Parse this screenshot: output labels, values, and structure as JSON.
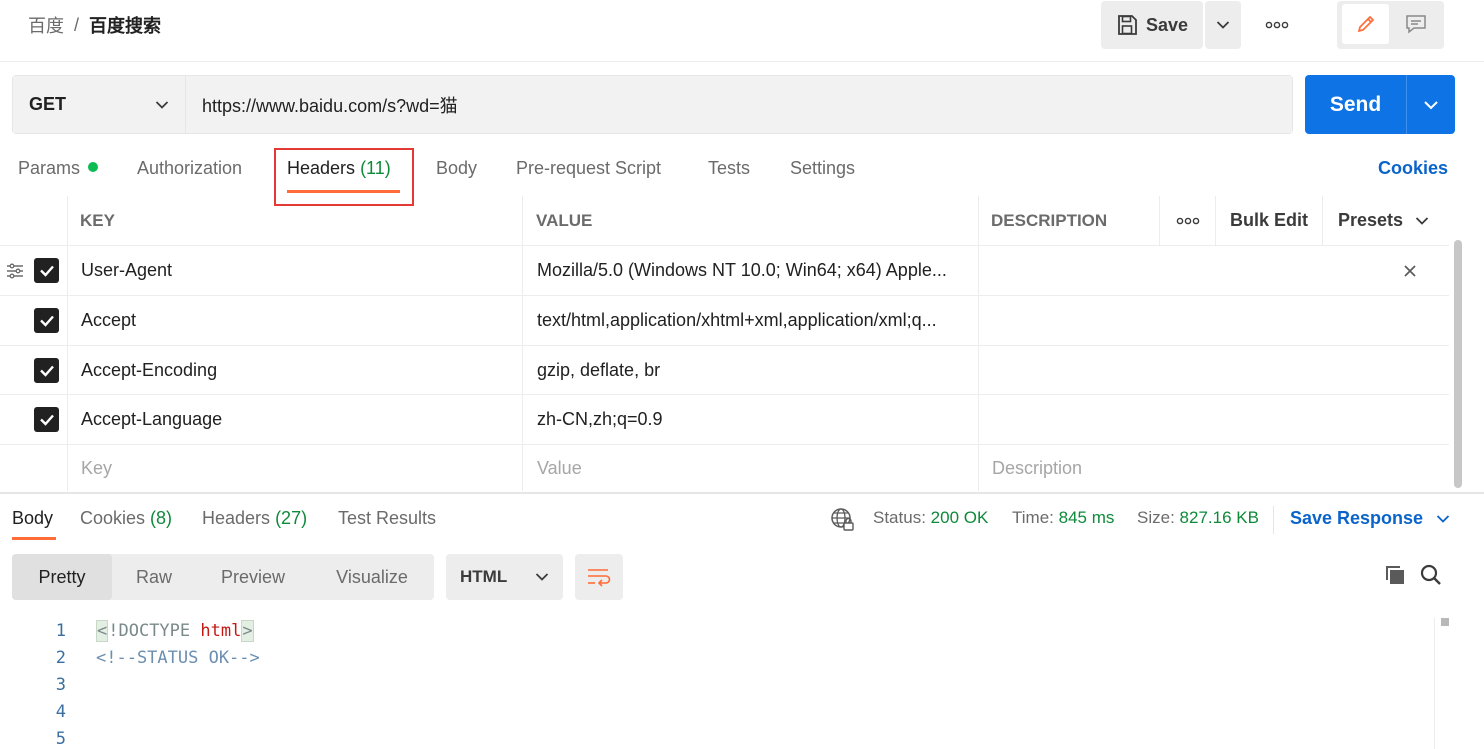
{
  "breadcrumb": {
    "parent": "百度",
    "separator": "/",
    "current": "百度搜索"
  },
  "toolbar": {
    "save_label": "Save",
    "more_icon": "more-horizontal-icon"
  },
  "request": {
    "method": "GET",
    "url": "https://www.baidu.com/s?wd=猫",
    "send_label": "Send"
  },
  "request_tabs": {
    "params": "Params",
    "authorization": "Authorization",
    "headers": "Headers",
    "headers_count": "(11)",
    "body": "Body",
    "pre_request": "Pre-request Script",
    "tests": "Tests",
    "settings": "Settings",
    "cookies": "Cookies"
  },
  "headers_table": {
    "columns": {
      "key": "KEY",
      "value": "VALUE",
      "description": "DESCRIPTION",
      "bulk_edit": "Bulk Edit",
      "presets": "Presets"
    },
    "rows": [
      {
        "key": "User-Agent",
        "value": "Mozilla/5.0 (Windows NT 10.0; Win64; x64) Apple...",
        "description": "",
        "checked": true
      },
      {
        "key": "Accept",
        "value": "text/html,application/xhtml+xml,application/xml;q...",
        "description": "",
        "checked": true
      },
      {
        "key": "Accept-Encoding",
        "value": "gzip, deflate, br",
        "description": "",
        "checked": true
      },
      {
        "key": "Accept-Language",
        "value": "zh-CN,zh;q=0.9",
        "description": "",
        "checked": true
      }
    ],
    "placeholders": {
      "key": "Key",
      "value": "Value",
      "description": "Description"
    }
  },
  "response": {
    "tabs": {
      "body": "Body",
      "cookies": "Cookies",
      "cookies_count": "(8)",
      "headers": "Headers",
      "headers_count": "(27)",
      "test_results": "Test Results"
    },
    "status_label": "Status:",
    "status_value": "200 OK",
    "time_label": "Time:",
    "time_value": "845 ms",
    "size_label": "Size:",
    "size_value": "827.16 KB",
    "save_response": "Save Response",
    "formats": [
      "Pretty",
      "Raw",
      "Preview",
      "Visualize"
    ],
    "active_format": "Pretty",
    "language": "HTML",
    "code_lines": [
      {
        "num": "1",
        "open": "<",
        "doctype": "!DOCTYPE ",
        "tag": "html",
        "close": ">"
      },
      {
        "num": "2",
        "comment": "<!--STATUS OK-->"
      },
      {
        "num": "3"
      },
      {
        "num": "4"
      },
      {
        "num": "5"
      }
    ]
  },
  "colors": {
    "accent": "#ff6c37",
    "primary": "#0e74e6",
    "success": "#0d8a3a",
    "link": "#0b64c9"
  }
}
